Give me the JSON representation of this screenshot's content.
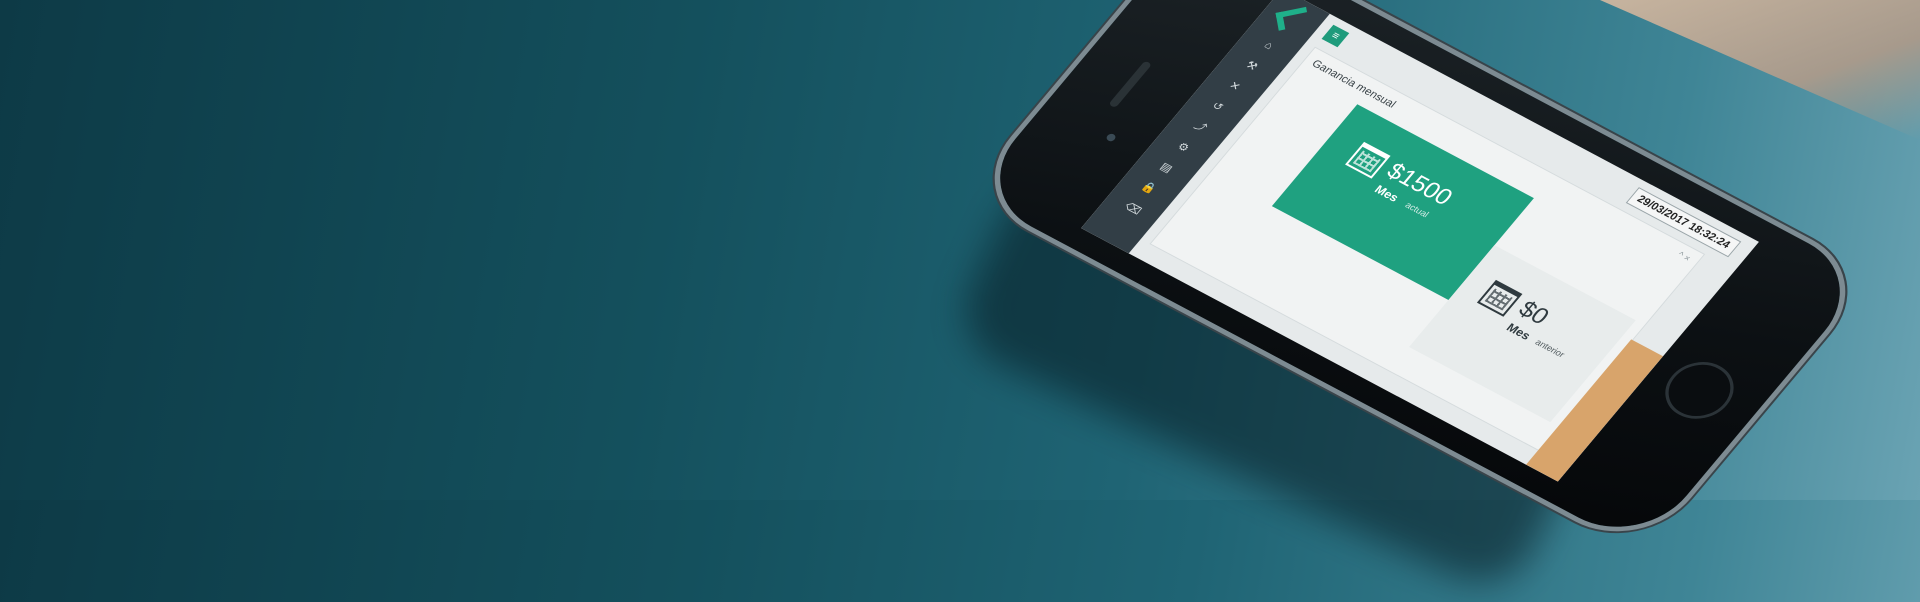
{
  "screen": {
    "datetime": "29/03/2017 18:32:24",
    "menu_glyph": "≡",
    "panel_title": "Ganancia mensual",
    "panel_controls": "^ ×",
    "current": {
      "amount": "$1500",
      "period": "Mes",
      "period_sub": "actual"
    },
    "previous": {
      "amount": "$0",
      "period": "Mes",
      "period_sub": "anterior"
    }
  },
  "sidebar_icons": [
    "home-icon",
    "tools-icon",
    "close-icon",
    "undo-icon",
    "chart-icon",
    "gear-icon",
    "document-icon",
    "lock-icon",
    "trash-icon"
  ],
  "colors": {
    "accent": "#1fa180",
    "sidebar": "#323e46",
    "surface": "#0d3a46"
  }
}
